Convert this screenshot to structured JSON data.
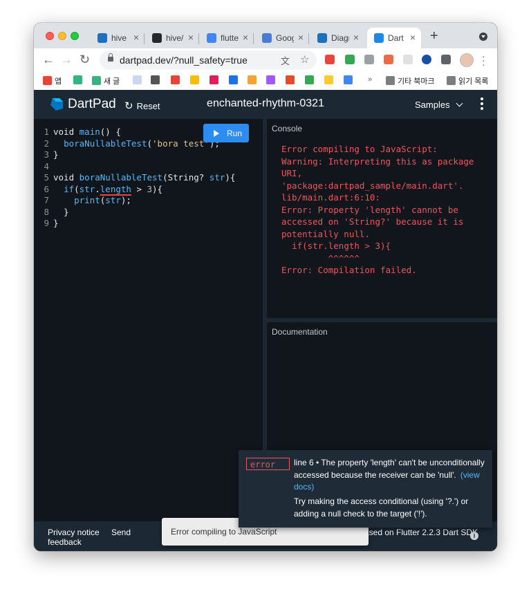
{
  "browser": {
    "tabs": [
      {
        "title": "hive",
        "favicon_color": "#1e6fbf",
        "active": false
      },
      {
        "title": "hive/",
        "favicon_color": "#24292e",
        "active": false
      },
      {
        "title": "flutte",
        "favicon_color": "#4285f4",
        "active": false
      },
      {
        "title": "Goog",
        "favicon_color": "#4a7bd8",
        "active": false
      },
      {
        "title": "Diagr",
        "favicon_color": "#1e6fbf",
        "active": false
      },
      {
        "title": "Dart",
        "favicon_color": "#1e88e5",
        "active": true
      }
    ],
    "url": "dartpad.dev/?null_safety=true",
    "bookmarks": [
      {
        "label": "앱",
        "color": "#ea4335"
      },
      {
        "label": "",
        "color": "#36b37e"
      },
      {
        "label": "새 글",
        "color": "#36b37e"
      },
      {
        "label": "",
        "color": "#c9d7f0"
      },
      {
        "label": "",
        "color": "#555555"
      },
      {
        "label": "",
        "color": "#ea4335"
      },
      {
        "label": "",
        "color": "#fbbc04"
      },
      {
        "label": "",
        "color": "#e01e5a"
      },
      {
        "label": "",
        "color": "#1a73e8"
      },
      {
        "label": "",
        "color": "#f2a33a"
      },
      {
        "label": "",
        "color": "#a259ff"
      },
      {
        "label": "",
        "color": "#e44d26"
      },
      {
        "label": "",
        "color": "#34a853"
      },
      {
        "label": "",
        "color": "#ffca28"
      },
      {
        "label": "",
        "color": "#4285f4"
      }
    ],
    "bookmark_more": "»",
    "bookmark_folder": "기타 북마크",
    "reading_list": "읽기 목록"
  },
  "dartpad": {
    "brand": "DartPad",
    "reset": "Reset",
    "title": "enchanted-rhythm-0321",
    "samples": "Samples",
    "run": "Run",
    "code_lines": [
      {
        "n": "1",
        "parts": [
          [
            "kw",
            "void "
          ],
          [
            "fn",
            "main"
          ],
          [
            "kw",
            "() {"
          ]
        ]
      },
      {
        "n": "2",
        "parts": [
          [
            "kw",
            "  "
          ],
          [
            "fn",
            "boraNullableTest"
          ],
          [
            "kw",
            "("
          ],
          [
            "str",
            "'bora test'"
          ],
          [
            "kw",
            ");"
          ]
        ]
      },
      {
        "n": "3",
        "parts": [
          [
            "kw",
            "}"
          ]
        ]
      },
      {
        "n": "4",
        "parts": []
      },
      {
        "n": "5",
        "parts": [
          [
            "kw",
            "void "
          ],
          [
            "fn",
            "boraNullableTest"
          ],
          [
            "kw",
            "(String? "
          ],
          [
            "fn",
            "str"
          ],
          [
            "kw",
            "){"
          ]
        ]
      },
      {
        "n": "6",
        "parts": [
          [
            "kw",
            "  "
          ],
          [
            "fn",
            "if"
          ],
          [
            "kw",
            "("
          ],
          [
            "fn",
            "str"
          ],
          [
            "kw",
            "."
          ],
          [
            "sq",
            "length"
          ],
          [
            "kw",
            " > "
          ],
          [
            "num",
            "3"
          ],
          [
            "kw",
            "){"
          ]
        ]
      },
      {
        "n": "7",
        "parts": [
          [
            "kw",
            "    "
          ],
          [
            "fn",
            "print"
          ],
          [
            "kw",
            "("
          ],
          [
            "fn",
            "str"
          ],
          [
            "kw",
            ");"
          ]
        ]
      },
      {
        "n": "8",
        "parts": [
          [
            "kw",
            "  }"
          ]
        ]
      },
      {
        "n": "9",
        "parts": [
          [
            "kw",
            "}"
          ]
        ]
      }
    ],
    "console_header": "Console",
    "console_output": "Error compiling to JavaScript:\nWarning: Interpreting this as package URI,\n'package:dartpad_sample/main.dart'.\nlib/main.dart:6:10:\nError: Property 'length' cannot be accessed on 'String?' because it is potentially null.\n  if(str.length > 3){\n         ^^^^^^\nError: Compilation failed.",
    "docs_header": "Documentation",
    "issue": {
      "level": "error",
      "message": "line 6 • The property 'length' can't be unconditionally accessed because the receiver can be 'null'.",
      "view_docs": "(view docs)",
      "hint": "Try making the access conditional (using '?.') or adding a null check to the target ('!')."
    },
    "snackbar": "Error compiling to JavaScript",
    "footer": {
      "privacy": "Privacy notice",
      "send": "Send",
      "feedback": "feedback",
      "sdk": "Based on Flutter 2.2.3 Dart SDK"
    },
    "colors": {
      "accent": "#2d8cf0",
      "error": "#f0545c",
      "function": "#56b6f7",
      "string": "#e2c08d"
    }
  }
}
